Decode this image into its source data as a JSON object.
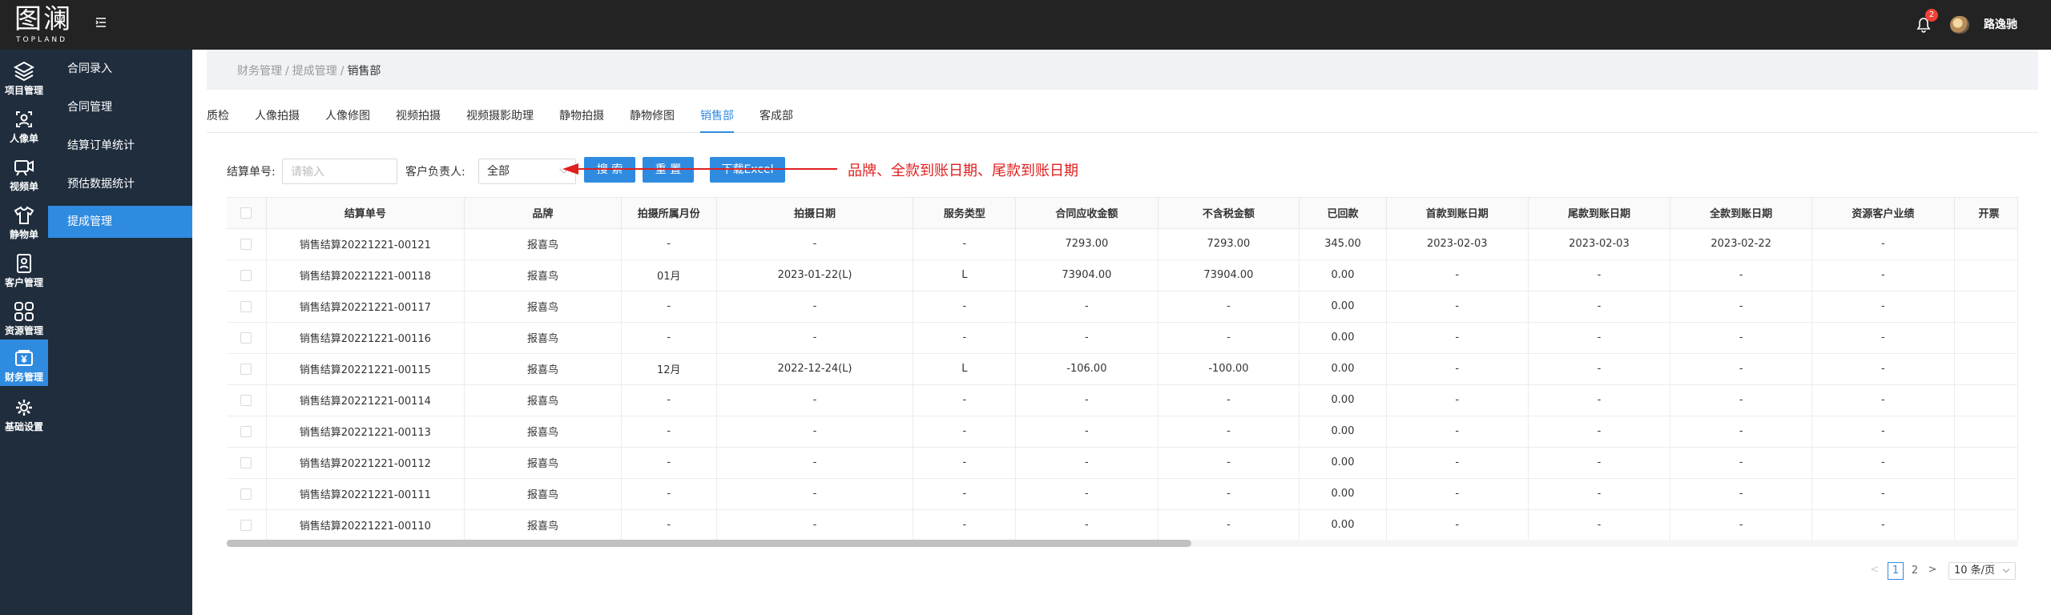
{
  "header": {
    "logo_main": "图澜",
    "logo_sub": "TOPLAND",
    "notification_count": "2",
    "username": "路逸驰"
  },
  "rail": [
    {
      "label": "项目管理",
      "icon": "layers-icon"
    },
    {
      "label": "人像单",
      "icon": "portrait-icon"
    },
    {
      "label": "视频单",
      "icon": "video-icon"
    },
    {
      "label": "静物单",
      "icon": "shirt-icon"
    },
    {
      "label": "客户管理",
      "icon": "contact-card-icon"
    },
    {
      "label": "资源管理",
      "icon": "grid-icon"
    },
    {
      "label": "财务管理",
      "icon": "yuan-icon"
    },
    {
      "label": "基础设置",
      "icon": "gear-icon"
    }
  ],
  "submenu": [
    "合同录入",
    "合同管理",
    "结算订单统计",
    "预估数据统计",
    "提成管理"
  ],
  "breadcrumb": [
    "财务管理",
    "提成管理",
    "销售部"
  ],
  "tabs": [
    "质检",
    "人像拍摄",
    "人像修图",
    "视频拍摄",
    "视频摄影助理",
    "静物拍摄",
    "静物修图",
    "销售部",
    "客成部"
  ],
  "filters": {
    "order_label": "结算单号:",
    "order_placeholder": "请输入",
    "owner_label": "客户负责人:",
    "owner_value": "全部",
    "search_button": "搜 索",
    "reset_button": "重 置",
    "excel_button": "下载Excel"
  },
  "annotation": "品牌、全款到账日期、尾款到账日期",
  "table": {
    "headers": [
      "结算单号",
      "品牌",
      "拍摄所属月份",
      "拍摄日期",
      "服务类型",
      "合同应收金额",
      "不含税金额",
      "已回款",
      "首款到账日期",
      "尾款到账日期",
      "全款到账日期",
      "资源客户业绩",
      "开票"
    ],
    "rows": [
      [
        "销售结算20221221-00121",
        "报喜鸟",
        "-",
        "-",
        "-",
        "7293.00",
        "7293.00",
        "345.00",
        "2023-02-03",
        "2023-02-03",
        "2023-02-22",
        "-",
        ""
      ],
      [
        "销售结算20221221-00118",
        "报喜鸟",
        "01月",
        "2023-01-22(L)",
        "L",
        "73904.00",
        "73904.00",
        "0.00",
        "-",
        "-",
        "-",
        "-",
        ""
      ],
      [
        "销售结算20221221-00117",
        "报喜鸟",
        "-",
        "-",
        "-",
        "-",
        "-",
        "0.00",
        "-",
        "-",
        "-",
        "-",
        ""
      ],
      [
        "销售结算20221221-00116",
        "报喜鸟",
        "-",
        "-",
        "-",
        "-",
        "-",
        "0.00",
        "-",
        "-",
        "-",
        "-",
        ""
      ],
      [
        "销售结算20221221-00115",
        "报喜鸟",
        "12月",
        "2022-12-24(L)",
        "L",
        "-106.00",
        "-100.00",
        "0.00",
        "-",
        "-",
        "-",
        "-",
        ""
      ],
      [
        "销售结算20221221-00114",
        "报喜鸟",
        "-",
        "-",
        "-",
        "-",
        "-",
        "0.00",
        "-",
        "-",
        "-",
        "-",
        ""
      ],
      [
        "销售结算20221221-00113",
        "报喜鸟",
        "-",
        "-",
        "-",
        "-",
        "-",
        "0.00",
        "-",
        "-",
        "-",
        "-",
        ""
      ],
      [
        "销售结算20221221-00112",
        "报喜鸟",
        "-",
        "-",
        "-",
        "-",
        "-",
        "0.00",
        "-",
        "-",
        "-",
        "-",
        ""
      ],
      [
        "销售结算20221221-00111",
        "报喜鸟",
        "-",
        "-",
        "-",
        "-",
        "-",
        "0.00",
        "-",
        "-",
        "-",
        "-",
        ""
      ],
      [
        "销售结算20221221-00110",
        "报喜鸟",
        "-",
        "-",
        "-",
        "-",
        "-",
        "0.00",
        "-",
        "-",
        "-",
        "-",
        ""
      ]
    ]
  },
  "pagination": {
    "prev": "<",
    "pages": [
      "1",
      "2"
    ],
    "current": "1",
    "next": ">",
    "page_size": "10 条/页"
  },
  "colors": {
    "accent": "#2f8be0",
    "sidebar": "#1f2d3d",
    "topbar": "#232323",
    "annotation": "#e02020"
  }
}
